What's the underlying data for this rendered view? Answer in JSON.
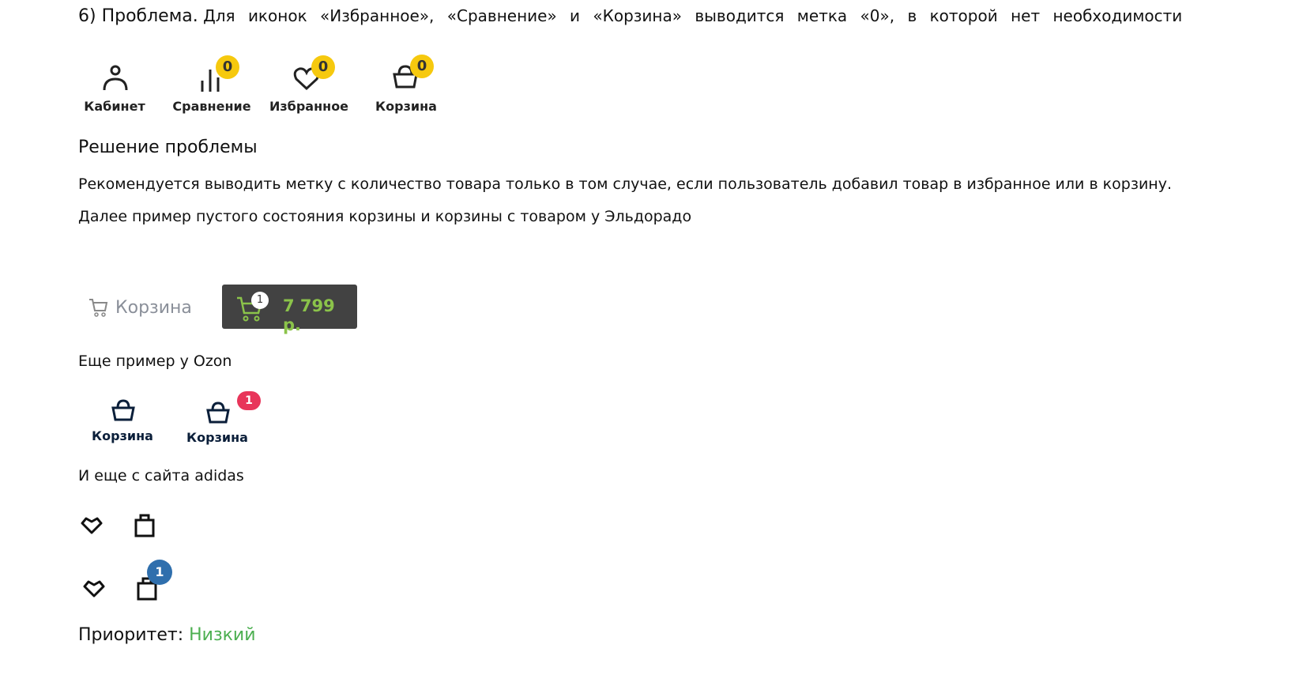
{
  "problem": {
    "title": "6) Проблема.",
    "text": "Для иконок «Избранное», «Сравнение» и «Корзина» выводится метка «0», в которой нет необходимости"
  },
  "header_icons": [
    {
      "label": "Кабинет",
      "icon": "user-icon",
      "badge": null
    },
    {
      "label": "Сравнение",
      "icon": "compare-icon",
      "badge": "0"
    },
    {
      "label": "Избранное",
      "icon": "heart-icon",
      "badge": "0"
    },
    {
      "label": "Корзина",
      "icon": "basket-icon",
      "badge": "0"
    }
  ],
  "solution": {
    "title": "Решение проблемы",
    "p1": "Рекомендуется выводить метку с количество товара только в том случае, если пользователь добавил товар в избранное или в корзину.",
    "p2": "Далее пример пустого состояния корзины и корзины с товаром у Эльдорадо"
  },
  "eldorado": {
    "empty_label": "Корзина",
    "count": "1",
    "price": "7 799 р."
  },
  "ozon": {
    "caption": "Еще пример у Ozon",
    "label": "Корзина",
    "count": "1"
  },
  "adidas": {
    "caption": "И еще с сайта adidas",
    "count": "1"
  },
  "priority": {
    "label": "Приоритет:",
    "value": "Низкий",
    "color": "#4caf50"
  }
}
